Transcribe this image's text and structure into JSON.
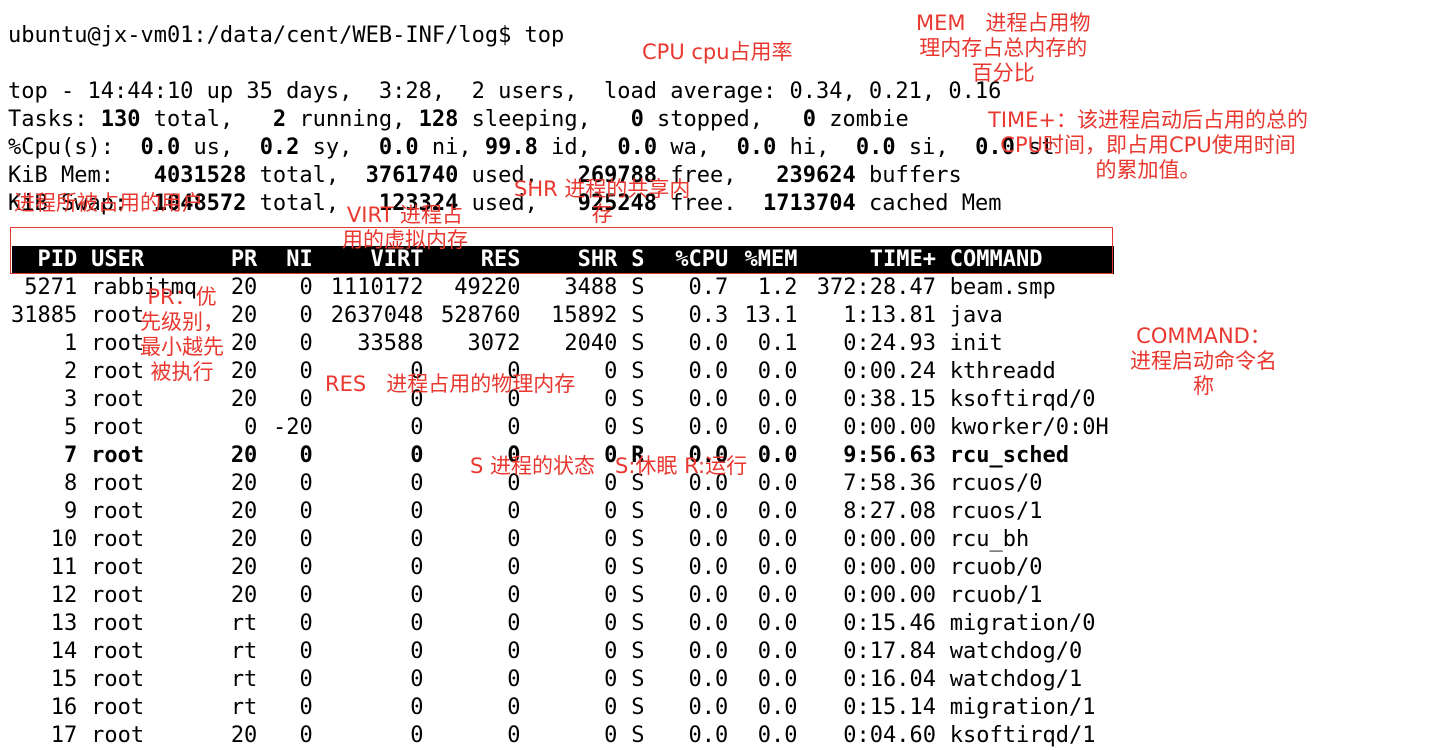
{
  "prompt": "ubuntu@jx-vm01:/data/cent/WEB-INF/log$ top",
  "summary": {
    "line1": "top - 14:44:10 up 35 days,  3:28,  2 users,  load average: 0.34, 0.21, 0.16",
    "tasks": [
      {
        "t": "Tasks: ",
        "b": false
      },
      {
        "t": "130",
        "b": true
      },
      {
        "t": " total,   ",
        "b": false
      },
      {
        "t": "2",
        "b": true
      },
      {
        "t": " running, ",
        "b": false
      },
      {
        "t": "128",
        "b": true
      },
      {
        "t": " sleeping,   ",
        "b": false
      },
      {
        "t": "0",
        "b": true
      },
      {
        "t": " stopped,   ",
        "b": false
      },
      {
        "t": "0",
        "b": true
      },
      {
        "t": " zombie",
        "b": false
      }
    ],
    "cpu": [
      {
        "t": "%Cpu(s):  ",
        "b": false
      },
      {
        "t": "0.0",
        "b": true
      },
      {
        "t": " us,  ",
        "b": false
      },
      {
        "t": "0.2",
        "b": true
      },
      {
        "t": " sy,  ",
        "b": false
      },
      {
        "t": "0.0",
        "b": true
      },
      {
        "t": " ni, ",
        "b": false
      },
      {
        "t": "99.8",
        "b": true
      },
      {
        "t": " id,  ",
        "b": false
      },
      {
        "t": "0.0",
        "b": true
      },
      {
        "t": " wa,  ",
        "b": false
      },
      {
        "t": "0.0",
        "b": true
      },
      {
        "t": " hi,  ",
        "b": false
      },
      {
        "t": "0.0",
        "b": true
      },
      {
        "t": " si,  ",
        "b": false
      },
      {
        "t": "0.0",
        "b": true
      },
      {
        "t": " st",
        "b": false
      }
    ],
    "mem": [
      {
        "t": "KiB Mem:   ",
        "b": false
      },
      {
        "t": "4031528",
        "b": true
      },
      {
        "t": " total,  ",
        "b": false
      },
      {
        "t": "3761740",
        "b": true
      },
      {
        "t": " used,   ",
        "b": false
      },
      {
        "t": "269788",
        "b": true
      },
      {
        "t": " free,   ",
        "b": false
      },
      {
        "t": "239624",
        "b": true
      },
      {
        "t": " buffers",
        "b": false
      }
    ],
    "swap": [
      {
        "t": "KiB Swap:  ",
        "b": false
      },
      {
        "t": "1048572",
        "b": true
      },
      {
        "t": " total,   ",
        "b": false
      },
      {
        "t": "123324",
        "b": true
      },
      {
        "t": " used,   ",
        "b": false
      },
      {
        "t": "925248",
        "b": true
      },
      {
        "t": " free.  ",
        "b": false
      },
      {
        "t": "1713704",
        "b": true
      },
      {
        "t": " cached Mem",
        "b": false
      }
    ]
  },
  "columns": [
    "PID",
    "USER",
    "PR",
    "NI",
    "VIRT",
    "RES",
    "SHR",
    "S",
    "%CPU",
    "%MEM",
    "TIME+",
    "COMMAND"
  ],
  "processes": [
    {
      "pid": "5271",
      "user": "rabbitmq",
      "pr": "20",
      "ni": "0",
      "virt": "1110172",
      "res": "49220",
      "shr": "3488",
      "s": "S",
      "cpu": "0.7",
      "mem": "1.2",
      "time": "372:28.47",
      "cmd": "beam.smp",
      "bold": false
    },
    {
      "pid": "31885",
      "user": "root",
      "pr": "20",
      "ni": "0",
      "virt": "2637048",
      "res": "528760",
      "shr": "15892",
      "s": "S",
      "cpu": "0.3",
      "mem": "13.1",
      "time": "1:13.81",
      "cmd": "java",
      "bold": false
    },
    {
      "pid": "1",
      "user": "root",
      "pr": "20",
      "ni": "0",
      "virt": "33588",
      "res": "3072",
      "shr": "2040",
      "s": "S",
      "cpu": "0.0",
      "mem": "0.1",
      "time": "0:24.93",
      "cmd": "init",
      "bold": false
    },
    {
      "pid": "2",
      "user": "root",
      "pr": "20",
      "ni": "0",
      "virt": "0",
      "res": "0",
      "shr": "0",
      "s": "S",
      "cpu": "0.0",
      "mem": "0.0",
      "time": "0:00.24",
      "cmd": "kthreadd",
      "bold": false
    },
    {
      "pid": "3",
      "user": "root",
      "pr": "20",
      "ni": "0",
      "virt": "0",
      "res": "0",
      "shr": "0",
      "s": "S",
      "cpu": "0.0",
      "mem": "0.0",
      "time": "0:38.15",
      "cmd": "ksoftirqd/0",
      "bold": false
    },
    {
      "pid": "5",
      "user": "root",
      "pr": "0",
      "ni": "-20",
      "virt": "0",
      "res": "0",
      "shr": "0",
      "s": "S",
      "cpu": "0.0",
      "mem": "0.0",
      "time": "0:00.00",
      "cmd": "kworker/0:0H",
      "bold": false
    },
    {
      "pid": "7",
      "user": "root",
      "pr": "20",
      "ni": "0",
      "virt": "0",
      "res": "0",
      "shr": "0",
      "s": "R",
      "cpu": "0.0",
      "mem": "0.0",
      "time": "9:56.63",
      "cmd": "rcu_sched",
      "bold": true
    },
    {
      "pid": "8",
      "user": "root",
      "pr": "20",
      "ni": "0",
      "virt": "0",
      "res": "0",
      "shr": "0",
      "s": "S",
      "cpu": "0.0",
      "mem": "0.0",
      "time": "7:58.36",
      "cmd": "rcuos/0",
      "bold": false
    },
    {
      "pid": "9",
      "user": "root",
      "pr": "20",
      "ni": "0",
      "virt": "0",
      "res": "0",
      "shr": "0",
      "s": "S",
      "cpu": "0.0",
      "mem": "0.0",
      "time": "8:27.08",
      "cmd": "rcuos/1",
      "bold": false
    },
    {
      "pid": "10",
      "user": "root",
      "pr": "20",
      "ni": "0",
      "virt": "0",
      "res": "0",
      "shr": "0",
      "s": "S",
      "cpu": "0.0",
      "mem": "0.0",
      "time": "0:00.00",
      "cmd": "rcu_bh",
      "bold": false
    },
    {
      "pid": "11",
      "user": "root",
      "pr": "20",
      "ni": "0",
      "virt": "0",
      "res": "0",
      "shr": "0",
      "s": "S",
      "cpu": "0.0",
      "mem": "0.0",
      "time": "0:00.00",
      "cmd": "rcuob/0",
      "bold": false
    },
    {
      "pid": "12",
      "user": "root",
      "pr": "20",
      "ni": "0",
      "virt": "0",
      "res": "0",
      "shr": "0",
      "s": "S",
      "cpu": "0.0",
      "mem": "0.0",
      "time": "0:00.00",
      "cmd": "rcuob/1",
      "bold": false
    },
    {
      "pid": "13",
      "user": "root",
      "pr": "rt",
      "ni": "0",
      "virt": "0",
      "res": "0",
      "shr": "0",
      "s": "S",
      "cpu": "0.0",
      "mem": "0.0",
      "time": "0:15.46",
      "cmd": "migration/0",
      "bold": false
    },
    {
      "pid": "14",
      "user": "root",
      "pr": "rt",
      "ni": "0",
      "virt": "0",
      "res": "0",
      "shr": "0",
      "s": "S",
      "cpu": "0.0",
      "mem": "0.0",
      "time": "0:17.84",
      "cmd": "watchdog/0",
      "bold": false
    },
    {
      "pid": "15",
      "user": "root",
      "pr": "rt",
      "ni": "0",
      "virt": "0",
      "res": "0",
      "shr": "0",
      "s": "S",
      "cpu": "0.0",
      "mem": "0.0",
      "time": "0:16.04",
      "cmd": "watchdog/1",
      "bold": false
    },
    {
      "pid": "16",
      "user": "root",
      "pr": "rt",
      "ni": "0",
      "virt": "0",
      "res": "0",
      "shr": "0",
      "s": "S",
      "cpu": "0.0",
      "mem": "0.0",
      "time": "0:15.14",
      "cmd": "migration/1",
      "bold": false
    },
    {
      "pid": "17",
      "user": "root",
      "pr": "20",
      "ni": "0",
      "virt": "0",
      "res": "0",
      "shr": "0",
      "s": "S",
      "cpu": "0.0",
      "mem": "0.0",
      "time": "0:04.60",
      "cmd": "ksoftirqd/1",
      "bold": false
    }
  ],
  "annotations": {
    "cpu": "CPU cpu占用率",
    "mem": "MEM   进程占用物\n理内存占总内存的\n百分比",
    "time": "TIME+：该进程启动后占用的总的\nCPU时间，即占用CPU使用时间\n的累加值。",
    "shr": "SHR 进程的共享内\n存",
    "virt": "VIRT 进程占\n用的虚拟内存",
    "user": "进程所被占用的用户",
    "pr": "PR：优\n先级别，\n最小越先\n被执行",
    "res": "RES   进程占用的物理内存",
    "command": "COMMAND：\n进程启动命令名\n称",
    "state": "S 进程的状态   S:休眠 R:运行"
  },
  "colors": {
    "annotation": "#e8382f",
    "header_bg": "#000000",
    "header_fg": "#ffffff"
  }
}
